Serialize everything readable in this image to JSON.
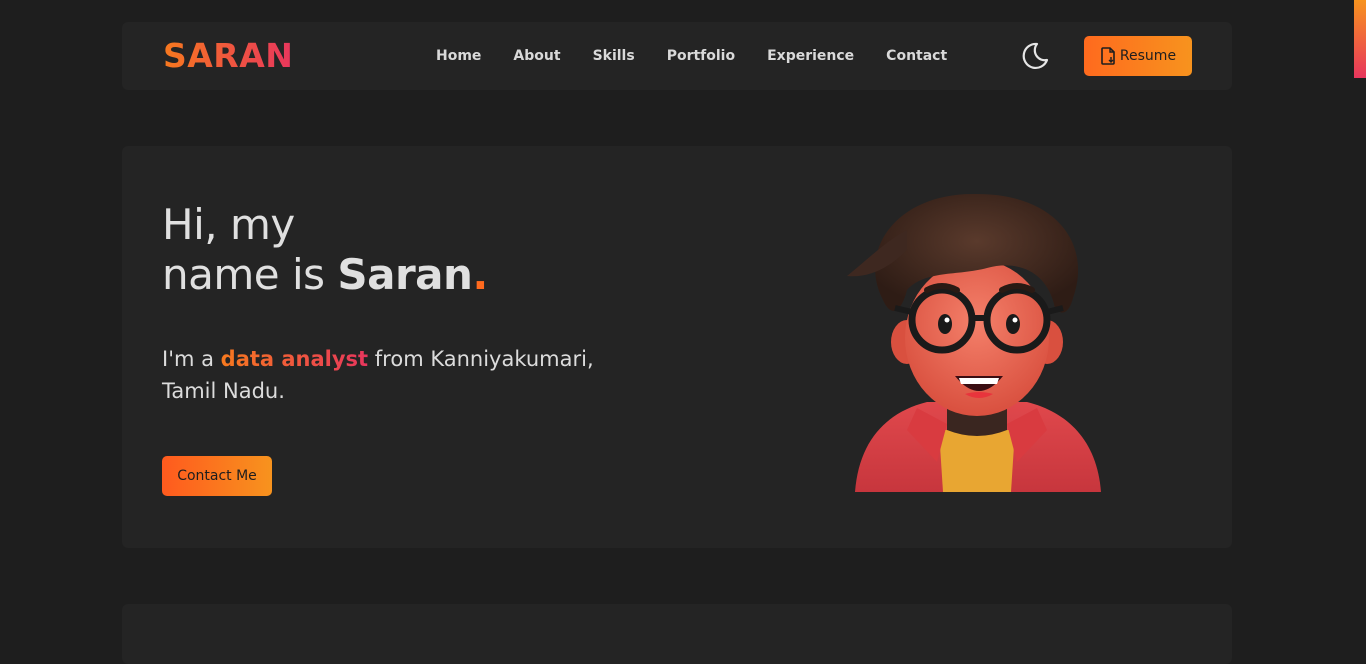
{
  "brand": {
    "logo": "SARAN",
    "accent_orange": "#ff6a1e",
    "accent_pink": "#e8365d"
  },
  "nav": {
    "items": [
      "Home",
      "About",
      "Skills",
      "Portfolio",
      "Experience",
      "Contact"
    ],
    "theme_icon": "moon-icon",
    "resume_label": "Resume",
    "resume_icon": "file-download-icon"
  },
  "hero": {
    "greeting_line1": "Hi, my",
    "greeting_line2_prefix": "name is ",
    "greeting_name": "Saran",
    "greeting_dot": ".",
    "intro_prefix": "I'm a ",
    "intro_role": "data analyst",
    "intro_suffix": " from Kanniyakumari, Tamil Nadu.",
    "contact_label": "Contact Me",
    "avatar_icon": "avatar-illustration"
  }
}
